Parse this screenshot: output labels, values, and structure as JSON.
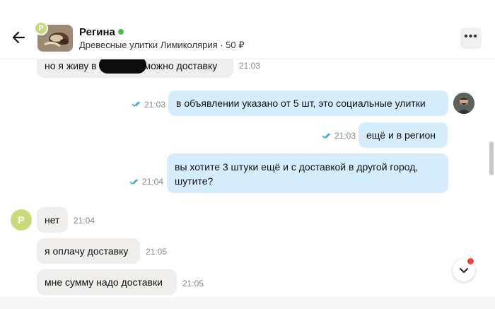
{
  "header": {
    "contact_initial": "Р",
    "contact_name": "Регина",
    "listing_title": "Древесные улитки Лимиколярия · 50 ₽",
    "online_color": "#46c04a"
  },
  "icons": {
    "back": "arrow-left-icon",
    "more": "more-dots-icon",
    "read": "double-check-icon",
    "scroll": "chevron-down-icon"
  },
  "messages": [
    {
      "dir": "in",
      "text_start": "но я живу в",
      "text_end": "можно доставку",
      "time": "21:03"
    },
    {
      "dir": "out",
      "text": "в объявлении указано от 5 шт, это социальные улитки",
      "time": "21:03",
      "read": true
    },
    {
      "dir": "out",
      "text": "ещё и в регион",
      "time": "21:03",
      "read": true
    },
    {
      "dir": "out",
      "text": "вы хотите 3 штуки ещё и с доставкой в другой город, шутите?",
      "time": "21:04",
      "read": true
    },
    {
      "dir": "in",
      "text": "нет",
      "time": "21:04",
      "avatar_initial": "Р"
    },
    {
      "dir": "in",
      "text": "я оплачу доставку",
      "time": "21:05"
    },
    {
      "dir": "in",
      "text": "мне сумму надо доставки",
      "time": "21:05"
    }
  ],
  "colors": {
    "incoming_bubble": "#efeeec",
    "outgoing_bubble": "#d5ecfc",
    "read_check": "#3aa0e6",
    "avatar_bg": "#c9da7a"
  }
}
